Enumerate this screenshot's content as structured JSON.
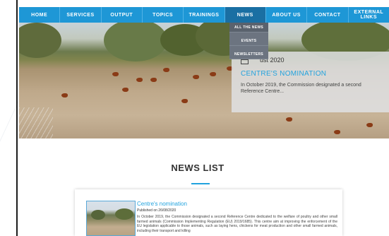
{
  "nav": {
    "items": [
      {
        "label": "Home"
      },
      {
        "label": "Services"
      },
      {
        "label": "Output"
      },
      {
        "label": "Topics"
      },
      {
        "label": "Trainings"
      },
      {
        "label": "News"
      },
      {
        "label": "About us"
      },
      {
        "label": "Contact"
      },
      {
        "label": "External links"
      }
    ],
    "active": "News",
    "accent_color": "#1e97d6"
  },
  "dropdown": {
    "items": [
      {
        "label": "All the News"
      },
      {
        "label": "Events"
      },
      {
        "label": "Newsletters"
      }
    ]
  },
  "hero_card": {
    "date": "ust 2020",
    "title": "CENTRE'S NOMINATION",
    "text": "In October 2019, the Commission designated a second Reference Centre..."
  },
  "news_list": {
    "title": "NEWS LIST",
    "article": {
      "title": "Centre's nomination",
      "published": "Published on 26/08/2020",
      "text": "In October 2019, the Commission designated a second Reference Centre dedicated to the welfare of poultry and other small farmed animals (Commission Implementing Regulation (EU) 2019/1685). This centre aim at improving the enforcement of the EU legislation applicable to those animals, such as laying hens, chickens for meat production and other small farmed animals, including their transport and killing"
    }
  }
}
